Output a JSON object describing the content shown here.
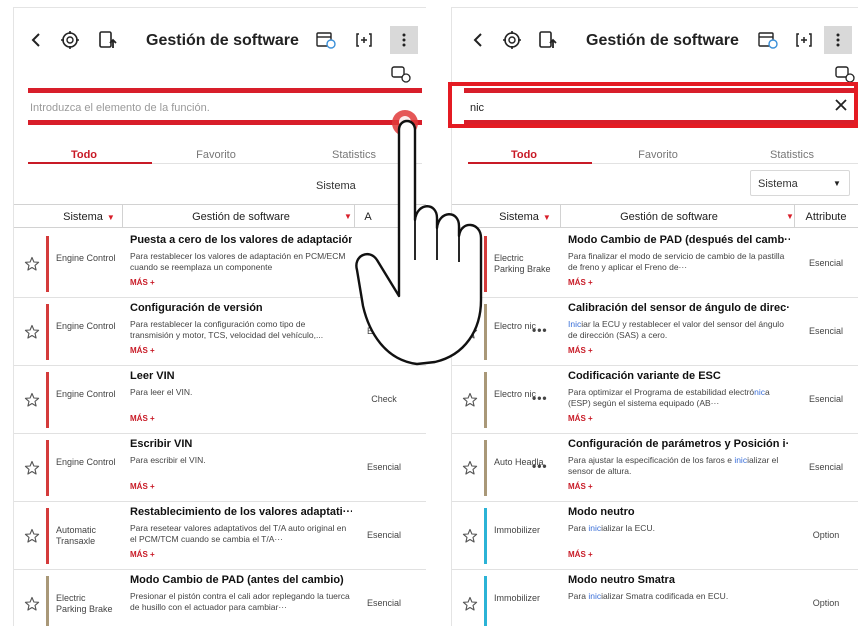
{
  "colors": {
    "accent": "#c81a26",
    "red_line": "#d81e2a",
    "bar_red": "#d43b3b",
    "bar_tan": "#a99878",
    "bar_cyan": "#2bb3d6",
    "highlight": "#3a6fd8"
  },
  "left": {
    "title": "Gestión de software",
    "search": {
      "placeholder": "Introduzca el elemento de la función.",
      "value": ""
    },
    "tabs": [
      "Todo",
      "Favorito",
      "Statistics"
    ],
    "filter_label": "Sistema",
    "columns": {
      "system": "Sistema",
      "function": "Gestión de software",
      "attribute": "A"
    },
    "rows": [
      {
        "system": "Engine Control",
        "title": "Puesta a cero de los valores de adaptación",
        "desc": "Para restablecer los valores de adaptación en PCM/ECM cuando se reemplaza un componente",
        "more": "MÁS +",
        "attribute": ""
      },
      {
        "system": "Engine Control",
        "title": "Configuración de versión",
        "desc": "Para restablecer la configuración como tipo de transmisión y motor, TCS, velocidad del vehículo,...",
        "more": "MÁS +",
        "attribute": "Esencial"
      },
      {
        "system": "Engine Control",
        "title": "Leer VIN",
        "desc": "Para leer el VIN.",
        "more": "MÁS +",
        "attribute": "Check"
      },
      {
        "system": "Engine Control",
        "title": "Escribir VIN",
        "desc": "Para escribir el VIN.",
        "more": "MÁS +",
        "attribute": "Esencial"
      },
      {
        "system": "Automatic Transaxle",
        "title": "Restablecimiento de los valores adaptati···",
        "desc": "Para resetear valores adaptativos del T/A auto original en el PCM/TCM cuando se cambia el T/A···",
        "more": "MÁS +",
        "attribute": "Esencial"
      },
      {
        "system": "Electric Parking Brake",
        "title": "Modo Cambio de PAD (antes del cambio)",
        "desc": "Presionar el pistón contra el cali ador replegando la tuerca de husillo con el actuador para cambiar···",
        "more": "",
        "attribute": "Esencial"
      }
    ]
  },
  "right": {
    "title": "Gestión de software",
    "search": {
      "placeholder": "",
      "value": "nic"
    },
    "tabs": [
      "Todo",
      "Favorito",
      "Statistics"
    ],
    "filter_label": "Sistema",
    "columns": {
      "system": "Sistema",
      "function": "Gestión de software",
      "attribute": "Attribute"
    },
    "rows": [
      {
        "system": "Electric Parking Brake",
        "title": "Modo Cambio de PAD (después del camb···",
        "desc_parts": [
          "Para finalizar el modo de servicio de cambio de la pastilla de freno y aplicar el Freno de···"
        ],
        "more": "MÁS +",
        "attribute": "Esencial"
      },
      {
        "system": "Electro nic",
        "title": "Calibración del sensor de ángulo de direc···",
        "desc_parts": [
          "Inic",
          "iar la ECU y restablecer el valor del sensor del ángulo de dirección (SAS) a cero."
        ],
        "more": "MÁS +",
        "attribute": "Esencial"
      },
      {
        "system": "Electro nic",
        "title": "Codificación variante de ESC",
        "desc_parts": [
          "Para optimizar el Programa de estabilidad electró",
          "nic",
          "a (ESP) según el sistema equipado (AB···"
        ],
        "more": "MÁS +",
        "attribute": "Esencial"
      },
      {
        "system": "Auto Headla",
        "title": "Configuración de parámetros y Posición i···",
        "desc_parts": [
          "Para ajustar la especificación de los faros e ",
          "inic",
          "ializar el sensor de altura."
        ],
        "more": "MÁS +",
        "attribute": "Esencial"
      },
      {
        "system": "Immobilizer",
        "title": "Modo neutro",
        "desc_parts": [
          "Para ",
          "inic",
          "ializar la ECU."
        ],
        "more": "MÁS +",
        "attribute": "Option"
      },
      {
        "system": "Immobilizer",
        "title": "Modo neutro Smatra",
        "desc_parts": [
          "Para ",
          "inic",
          "ializar Smatra codificada en ECU."
        ],
        "more": "",
        "attribute": "Option"
      }
    ]
  }
}
